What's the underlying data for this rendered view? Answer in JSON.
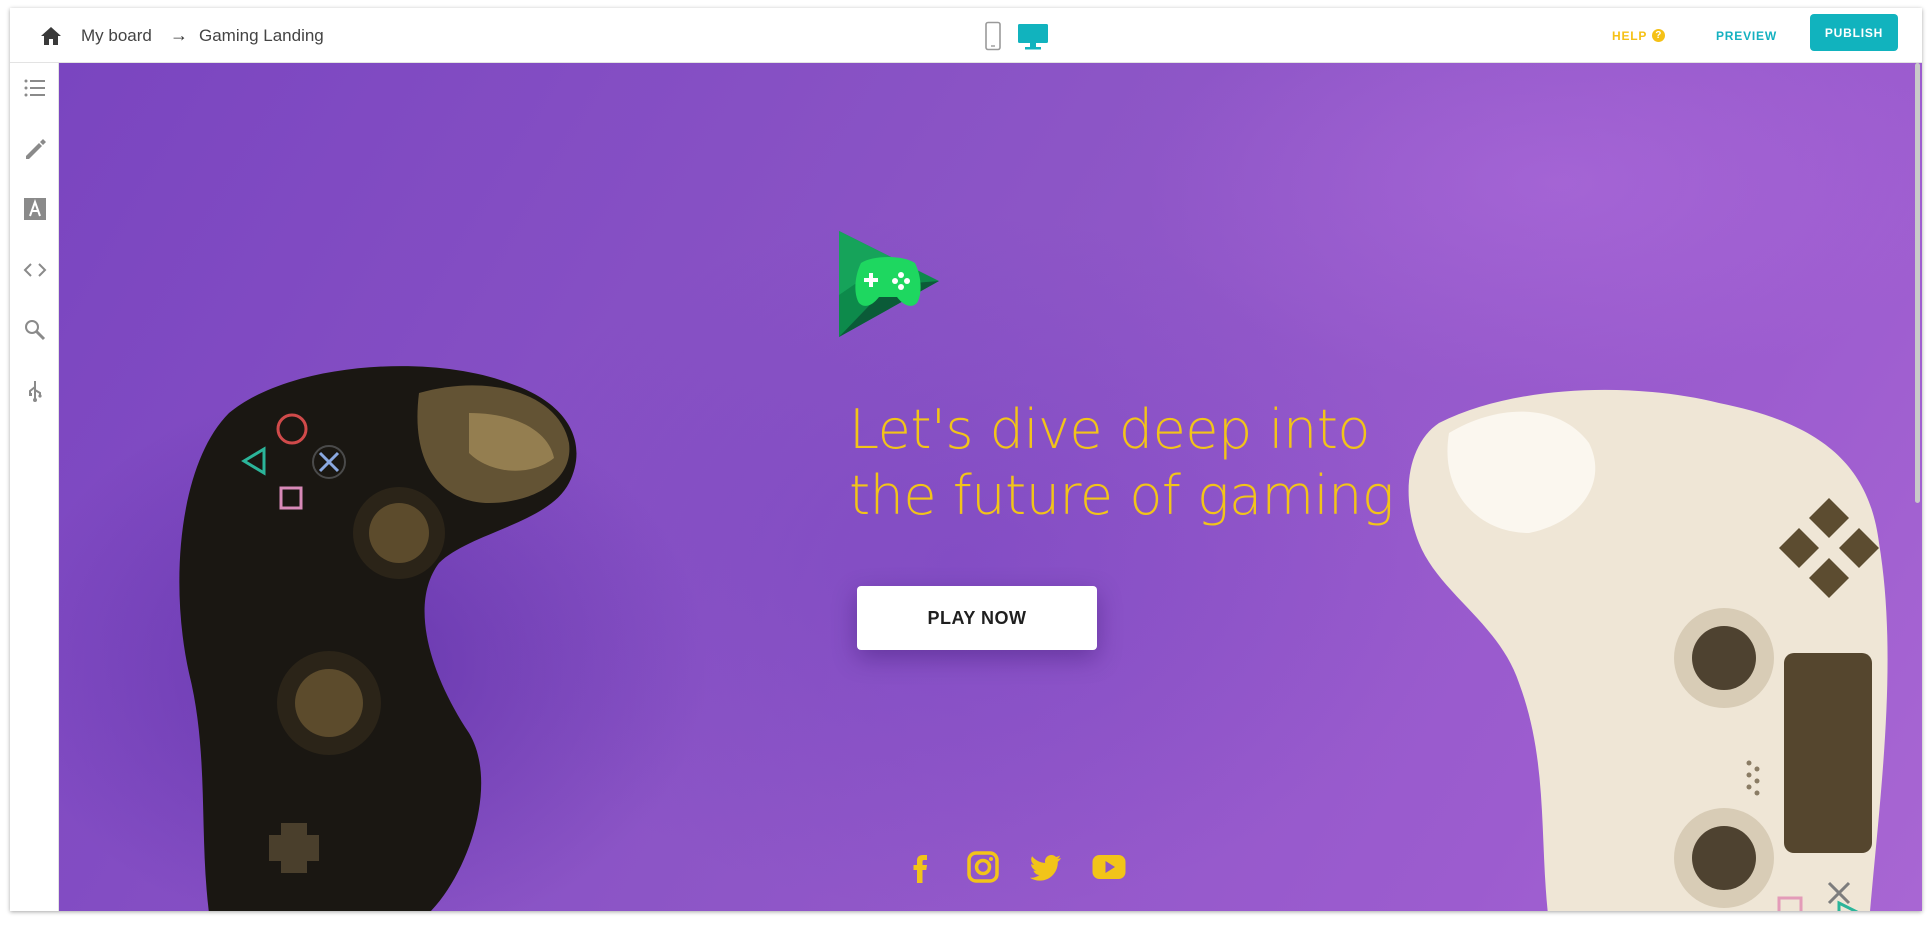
{
  "breadcrumb": {
    "board": "My board",
    "separator": "→",
    "page": "Gaming Landing"
  },
  "topbar": {
    "help_label": "HELP",
    "help_icon": "?",
    "preview_label": "PREVIEW",
    "publish_label": "PUBLISH",
    "active_device": "desktop"
  },
  "sidebar": {
    "icons": [
      "list-icon",
      "pencil-icon",
      "text-a-icon",
      "code-icon",
      "search-zoom-icon",
      "usb-icon"
    ]
  },
  "hero": {
    "headline_line1": "Let's dive deep into",
    "headline_line2": "the future of gaming",
    "cta_label": "PLAY NOW",
    "social": [
      "facebook-icon",
      "instagram-icon",
      "twitter-icon",
      "youtube-icon"
    ]
  },
  "colors": {
    "accent_teal": "#11b3be",
    "help_yellow": "#f5c116",
    "headline_yellow": "#f2c419",
    "canvas_purple": "#8c55c6",
    "logo_green": "#1ed760"
  }
}
